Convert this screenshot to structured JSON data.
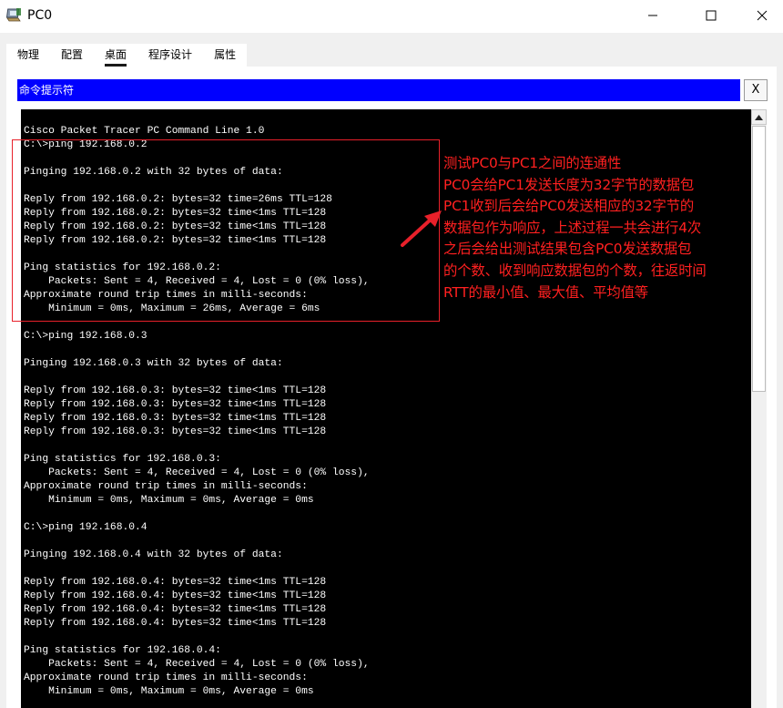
{
  "window": {
    "title": "PC0",
    "icon": "packet-tracer-pc-icon",
    "controls": {
      "minimize": "minimize-icon",
      "maximize": "maximize-icon",
      "close": "close-icon"
    }
  },
  "tabs": [
    {
      "label": "物理",
      "active": false
    },
    {
      "label": "配置",
      "active": false
    },
    {
      "label": "桌面",
      "active": true
    },
    {
      "label": "程序设计",
      "active": false
    },
    {
      "label": "属性",
      "active": false
    }
  ],
  "command_prompt": {
    "title": "命令提示符",
    "close_label": "X",
    "header_color": "#0000ff",
    "output": "Cisco Packet Tracer PC Command Line 1.0\nC:\\>ping 192.168.0.2\n\nPinging 192.168.0.2 with 32 bytes of data:\n\nReply from 192.168.0.2: bytes=32 time=26ms TTL=128\nReply from 192.168.0.2: bytes=32 time<1ms TTL=128\nReply from 192.168.0.2: bytes=32 time<1ms TTL=128\nReply from 192.168.0.2: bytes=32 time<1ms TTL=128\n\nPing statistics for 192.168.0.2:\n    Packets: Sent = 4, Received = 4, Lost = 0 (0% loss),\nApproximate round trip times in milli-seconds:\n    Minimum = 0ms, Maximum = 26ms, Average = 6ms\n\nC:\\>ping 192.168.0.3\n\nPinging 192.168.0.3 with 32 bytes of data:\n\nReply from 192.168.0.3: bytes=32 time<1ms TTL=128\nReply from 192.168.0.3: bytes=32 time<1ms TTL=128\nReply from 192.168.0.3: bytes=32 time<1ms TTL=128\nReply from 192.168.0.3: bytes=32 time<1ms TTL=128\n\nPing statistics for 192.168.0.3:\n    Packets: Sent = 4, Received = 4, Lost = 0 (0% loss),\nApproximate round trip times in milli-seconds:\n    Minimum = 0ms, Maximum = 0ms, Average = 0ms\n\nC:\\>ping 192.168.0.4\n\nPinging 192.168.0.4 with 32 bytes of data:\n\nReply from 192.168.0.4: bytes=32 time<1ms TTL=128\nReply from 192.168.0.4: bytes=32 time<1ms TTL=128\nReply from 192.168.0.4: bytes=32 time<1ms TTL=128\nReply from 192.168.0.4: bytes=32 time<1ms TTL=128\n\nPing statistics for 192.168.0.4:\n    Packets: Sent = 4, Received = 4, Lost = 0 (0% loss),\nApproximate round trip times in milli-seconds:\n    Minimum = 0ms, Maximum = 0ms, Average = 0ms"
  },
  "annotation": {
    "color": "#ff2020",
    "lines": [
      "测试PC0与PC1之间的连通性",
      "PC0会给PC1发送长度为32字节的数据包",
      "PC1收到后会给PC0发送相应的32字节的",
      "数据包作为响应，上述过程一共会进行4次",
      "之后会给出测试结果包含PC0发送数据包",
      "的个数、收到响应数据包的个数，往返时间",
      "RTT的最小值、最大值、平均值等"
    ]
  }
}
